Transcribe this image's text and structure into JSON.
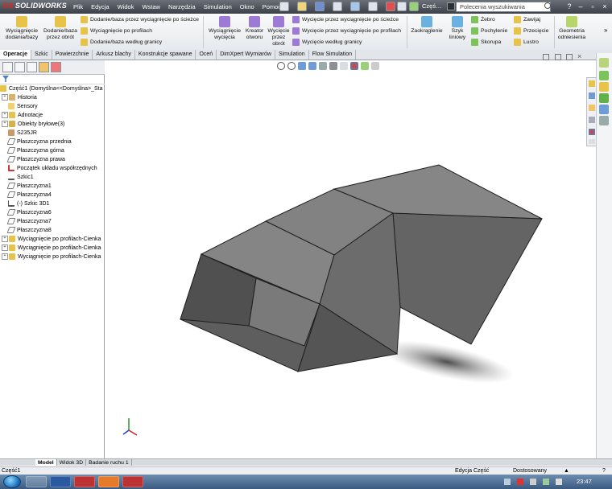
{
  "app": {
    "logo_text": "SOLIDWORKS",
    "logo_ds": "DS"
  },
  "menu": [
    "Plik",
    "Edycja",
    "Widok",
    "Wstaw",
    "Narzędzia",
    "Simulation",
    "Okno",
    "Pomoc"
  ],
  "search": {
    "category": "Częś…",
    "placeholder": "Polecenia wyszukiwania"
  },
  "ribbon": {
    "big": [
      "Wyciągnięcie\ndodania/bazy",
      "Dodanie/baza\nprzez obrót",
      "Wyciągnięcie\nwycięcia",
      "Kreator\notworu",
      "Wycięcie\nprzez\nobrót",
      "Zaokrąglenie",
      "Szyk\nliniowy",
      "Geometria\nodniesienia"
    ],
    "small_add": [
      "Dodanie/baza przez wyciągnięcie po ścieżce",
      "Wyciągnięcie po profilach",
      "Dodanie/baza według granicy"
    ],
    "small_cut": [
      "Wycięcie przez wyciągnięcie po ścieżce",
      "Wycięcie przez wyciągnięcie po profilach",
      "Wycięcie według granicy"
    ],
    "small_feat1": [
      "Żebro",
      "Pochylenie",
      "Skorupa"
    ],
    "small_feat2": [
      "Zawijaj",
      "Przecięcie",
      "Lustro"
    ]
  },
  "tabs": [
    "Operacje",
    "Szkic",
    "Powierzchnie",
    "Arkusz blachy",
    "Konstrukcje spawane",
    "Oceń",
    "DimXpert Wymiarów",
    "Simulation",
    "Flow Simulation"
  ],
  "tree": [
    "Część1  (Domyślna<<Domyślna>_Sta",
    "Historia",
    "Sensory",
    "Adnotacje",
    "Obiekty bryłowe(3)",
    "S235JR",
    "Płaszczyzna przednia",
    "Płaszczyzna górna",
    "Płaszczyzna prawa",
    "Początek układu współrzędnych",
    "Szkic1",
    "Płaszczyzna1",
    "Płaszczyzna4",
    "(-) Szkic 3D1",
    "Płaszczyzna6",
    "Płaszczyzna7",
    "Płaszczyzna8",
    "Wyciągnięcie po profilach-Cienka",
    "Wyciągnięcie po profilach-Cienka",
    "Wyciągnięcie po profilach-Cienka"
  ],
  "bottom_tabs": [
    "Model",
    "Widok 3D",
    "Badanie ruchu 1"
  ],
  "status": {
    "left": "Część1",
    "mode": "Edycja Część",
    "custom": "Dostosowany"
  },
  "clock": "23:47",
  "colors": {
    "accent": "#e0261c",
    "part_face": "#6f6f6f",
    "part_top": "#7d7d7d"
  }
}
